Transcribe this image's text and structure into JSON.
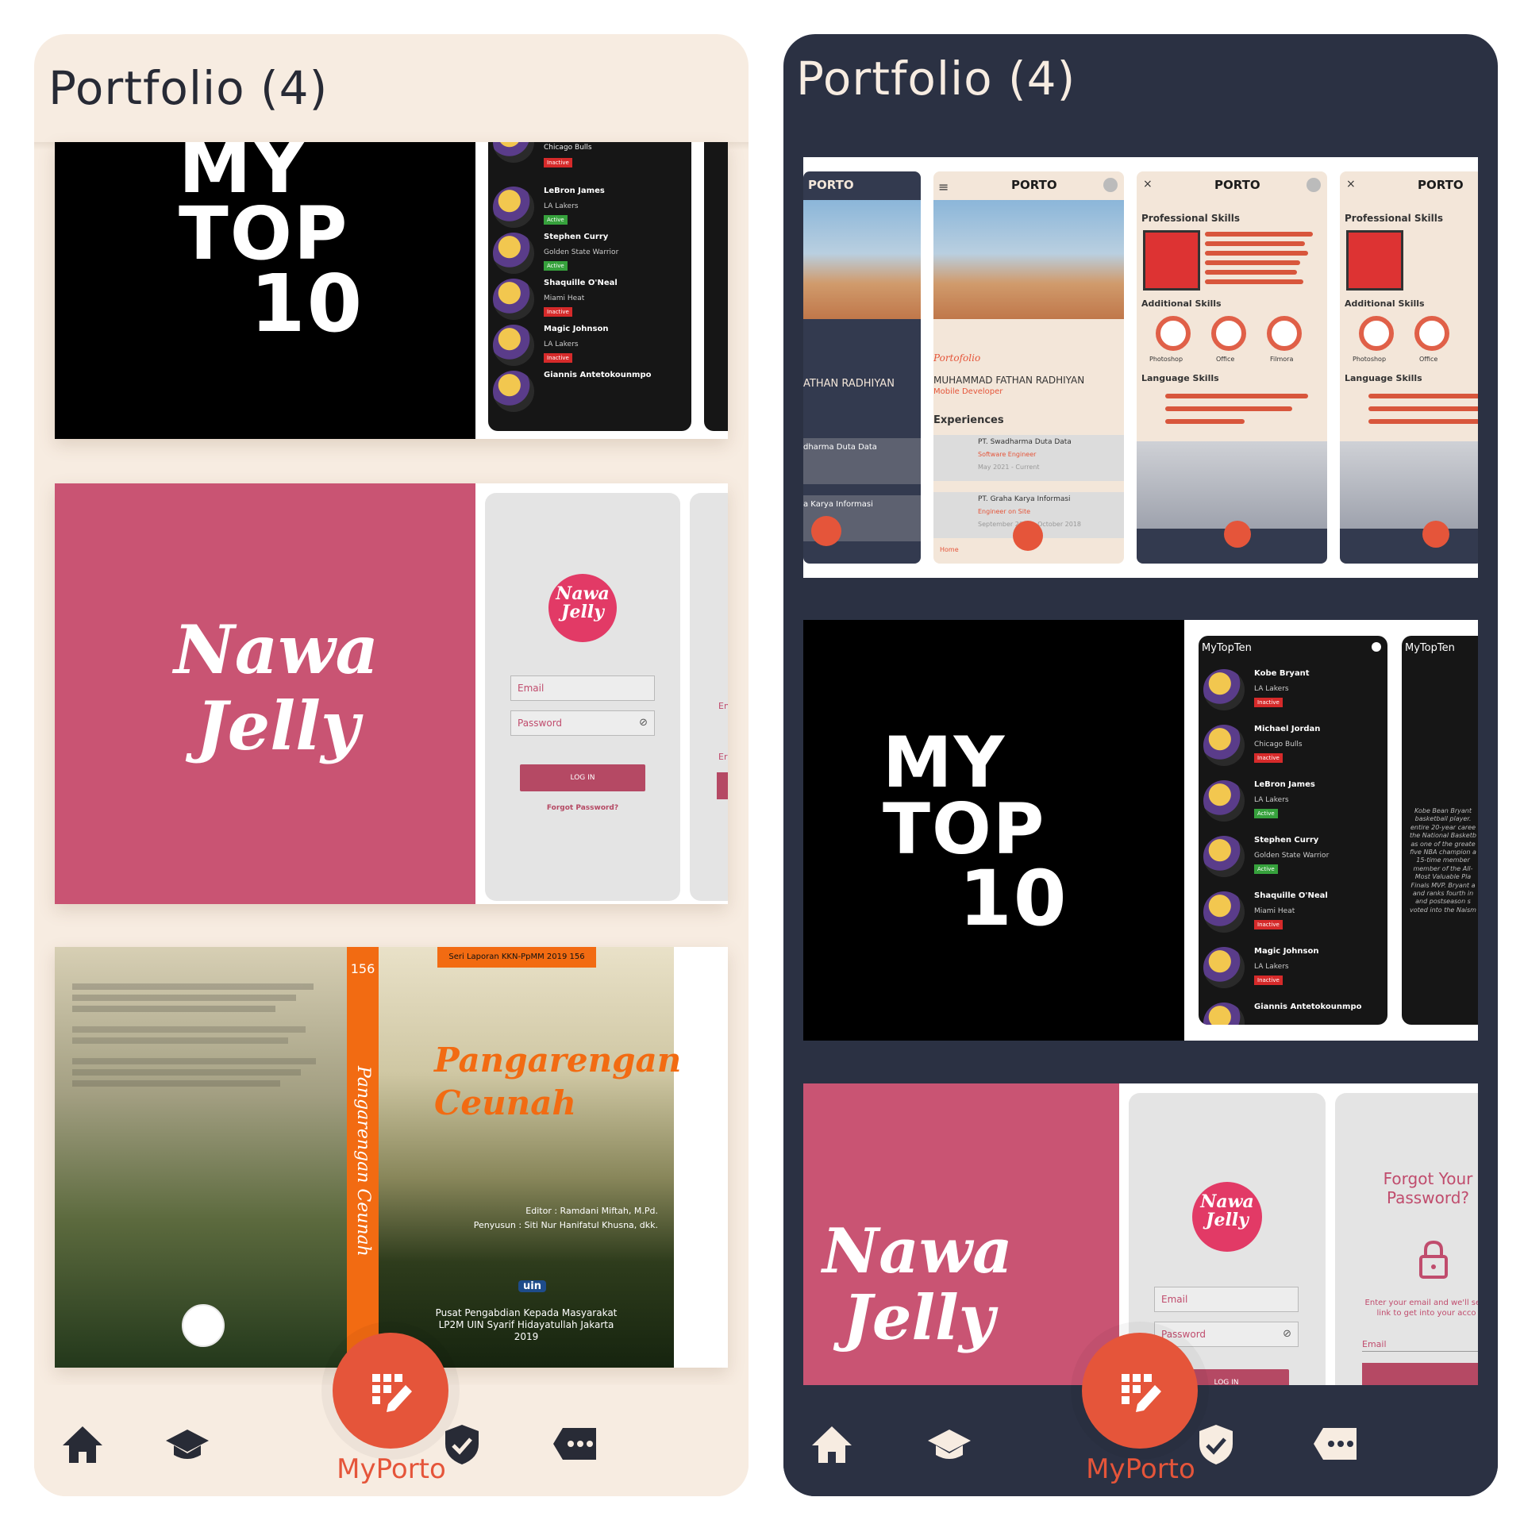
{
  "left_phone": {
    "title": "Portfolio (4)",
    "card1": {
      "cover_line1": "MY",
      "cover_line2": "TOP",
      "cover_line3": "10",
      "players": [
        {
          "name": "",
          "team": "Chicago Bulls",
          "status": "Inactive"
        },
        {
          "name": "LeBron James",
          "team": "LA Lakers",
          "status": "Active"
        },
        {
          "name": "Stephen Curry",
          "team": "Golden State Warrior",
          "status": "Active"
        },
        {
          "name": "Shaquille O'Neal",
          "team": "Miami Heat",
          "status": "Inactive"
        },
        {
          "name": "Magic Johnson",
          "team": "LA Lakers",
          "status": "Inactive"
        },
        {
          "name": "Giannis Antetokounmpo",
          "team": "",
          "status": ""
        }
      ]
    },
    "card2": {
      "brand_line1": "Nawa",
      "brand_line2": "Jelly",
      "logo_line1": "Nawa",
      "logo_line2": "Jelly",
      "email_placeholder": "Email",
      "password_placeholder": "Password",
      "login_label": "LOG IN",
      "forgot_label": "Forgot Password?",
      "peek_label1": "En",
      "peek_label2": "Er"
    },
    "card3": {
      "series_label": "Seri Laporan KKN-PpMM 2019 156",
      "spine_number": "156",
      "spine_title": "Pangarengan Ceunah",
      "title_line1": "Pangarengan",
      "title_line2": "Ceunah",
      "editor": "Editor : Ramdani Miftah, M.Pd.",
      "compiler": "Penyusun : Siti Nur Hanifatul Khusna, dkk.",
      "publisher_line1": "Pusat Pengabdian Kepada Masyarakat",
      "publisher_line2": "LP2M UIN Syarif Hidayatullah Jakarta",
      "publisher_year": "2019",
      "uin_label": "uin"
    },
    "nav": {
      "fab_label": "MyPorto"
    }
  },
  "right_phone": {
    "title": "Portfolio (4)",
    "card1": {
      "logo": "PORTO",
      "name_partial": "ATHAN RADHIYAN",
      "portfolio_label": "Portofolio",
      "full_name": "MUHAMMAD FATHAN RADHIYAN",
      "role": "Mobile Developer",
      "experiences_label": "Experiences",
      "exp1": "PT. Swadharma Duta Data",
      "exp1_role": "Software Engineer",
      "exp1_date": "May 2021 - Current",
      "exp2": "PT. Graha Karya Informasi",
      "exp2_role": "Engineer on Site",
      "exp2_date": "September 2018 - October 2018",
      "exp1_partial": "dharma Duta Data",
      "exp2_partial": "a Karya Informasi",
      "professional_skills": "Professional Skills",
      "additional_skills": "Additional Skills",
      "language_skills": "Language Skills",
      "skill_photoshop": "Photoshop",
      "skill_office": "Office",
      "skill_filmora": "Filmora",
      "home_label": "Home"
    },
    "card2": {
      "cover_line1": "MY",
      "cover_line2": "TOP",
      "cover_line3": "10",
      "app_title": "MyTopTen",
      "app_title2": "MyTopTen",
      "players": [
        {
          "name": "Kobe Bryant",
          "team": "LA Lakers",
          "status": "Inactive"
        },
        {
          "name": "Michael Jordan",
          "team": "Chicago Bulls",
          "status": "Inactive"
        },
        {
          "name": "LeBron James",
          "team": "LA Lakers",
          "status": "Active"
        },
        {
          "name": "Stephen Curry",
          "team": "Golden State Warrior",
          "status": "Active"
        },
        {
          "name": "Shaquille O'Neal",
          "team": "Miami Heat",
          "status": "Inactive"
        },
        {
          "name": "Magic Johnson",
          "team": "LA Lakers",
          "status": "Inactive"
        },
        {
          "name": "Giannis Antetokounmpo",
          "team": "",
          "status": ""
        }
      ],
      "bio": "Kobe Bean Bryant basketball player. entire 20-year caree the National Basketb as one of the greate five NBA champion a 15-time member member of the All- Most Valuable Pla Finals MVP. Bryant a and ranks fourth in and postseason s voted into the Naism"
    },
    "card3": {
      "brand_line1": "Nawa",
      "brand_line2": "Jelly",
      "logo_line1": "Nawa",
      "logo_line2": "Jelly",
      "email_placeholder": "Email",
      "password_placeholder": "Password",
      "login_label": "LOG IN",
      "forgot_title": "Forgot Your Password?",
      "forgot_text": "Enter your email and we'll se a link to get into your acco",
      "forgot_email": "Email"
    },
    "nav": {
      "fab_label": "MyPorto"
    }
  }
}
